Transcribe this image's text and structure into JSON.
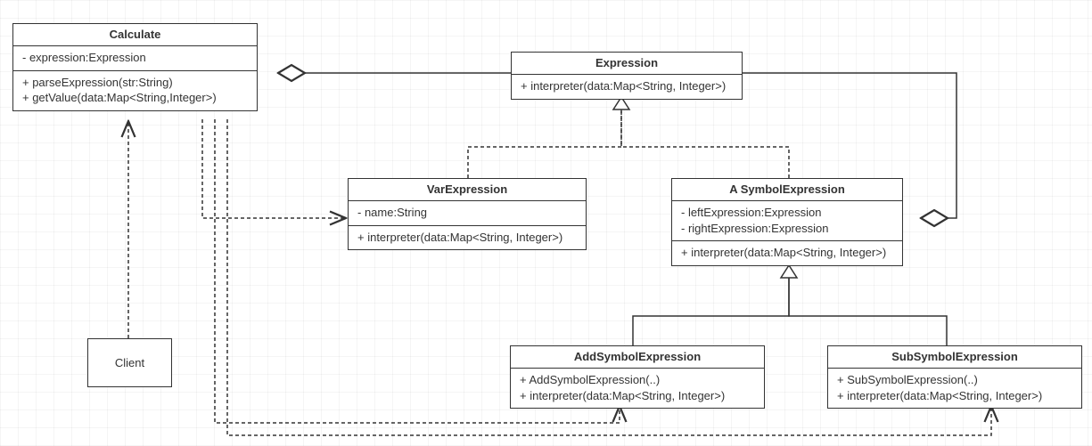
{
  "diagram_type": "UML Class Diagram",
  "pattern": "Interpreter Pattern",
  "classes": {
    "calculate": {
      "name": "Calculate",
      "fields": "- expression:Expression",
      "methods_line1": "+ parseExpression(str:String)",
      "methods_line2": "+ getValue(data:Map<String,Integer>)"
    },
    "expression": {
      "name": "Expression",
      "methods": "+ interpreter(data:Map<String, Integer>)"
    },
    "varExpression": {
      "name": "VarExpression",
      "fields": "- name:String",
      "methods": "+ interpreter(data:Map<String, Integer>)"
    },
    "symbolExpression": {
      "name": "A SymbolExpression",
      "fields_line1": "- leftExpression:Expression",
      "fields_line2": "- rightExpression:Expression",
      "methods": "+ interpreter(data:Map<String, Integer>)"
    },
    "addSymbol": {
      "name": "AddSymbolExpression",
      "methods_line1": "+ AddSymbolExpression(..)",
      "methods_line2": "+ interpreter(data:Map<String, Integer>)"
    },
    "subSymbol": {
      "name": "SubSymbolExpression",
      "methods_line1": "+ SubSymbolExpression(..)",
      "methods_line2": "+ interpreter(data:Map<String, Integer>)"
    },
    "client": {
      "name": "Client"
    }
  },
  "relations": [
    {
      "from": "Calculate",
      "to": "Expression",
      "type": "aggregation"
    },
    {
      "from": "VarExpression",
      "to": "Expression",
      "type": "generalization",
      "style": "dashed"
    },
    {
      "from": "SymbolExpression",
      "to": "Expression",
      "type": "generalization",
      "style": "dashed"
    },
    {
      "from": "SymbolExpression",
      "to": "Expression",
      "type": "aggregation"
    },
    {
      "from": "AddSymbolExpression",
      "to": "SymbolExpression",
      "type": "generalization"
    },
    {
      "from": "SubSymbolExpression",
      "to": "SymbolExpression",
      "type": "generalization"
    },
    {
      "from": "Client",
      "to": "Calculate",
      "type": "dependency"
    },
    {
      "from": "Calculate",
      "to": "VarExpression",
      "type": "dependency"
    },
    {
      "from": "Calculate",
      "to": "AddSymbolExpression",
      "type": "dependency"
    },
    {
      "from": "Calculate",
      "to": "SubSymbolExpression",
      "type": "dependency"
    }
  ]
}
